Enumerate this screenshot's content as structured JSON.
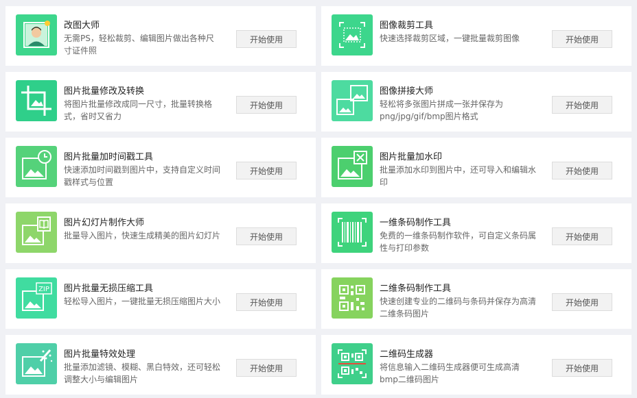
{
  "tools": [
    {
      "title": "改图大师",
      "desc": "无需PS，轻松裁剪、编辑图片做出各种尺寸证件照",
      "button": "开始使用",
      "icon": "id-photo-icon",
      "color": "#3dd68c"
    },
    {
      "title": "图像裁剪工具",
      "desc": "快速选择裁剪区域，一键批量裁剪图像",
      "button": "开始使用",
      "icon": "crop-area-icon",
      "color": "#3dd68c"
    },
    {
      "title": "图片批量修改及转换",
      "desc": "将图片批量修改成同一尺寸，批量转换格式，省时又省力",
      "button": "开始使用",
      "icon": "crop-resize-icon",
      "color": "#2fcf8a"
    },
    {
      "title": "图像拼接大师",
      "desc": "轻松将多张图片拼成一张并保存为png/jpg/gif/bmp图片格式",
      "button": "开始使用",
      "icon": "image-stitch-icon",
      "color": "#4ddba0"
    },
    {
      "title": "图片批量加时间戳工具",
      "desc": "快速添加时间戳到图片中，支持自定义时间戳样式与位置",
      "button": "开始使用",
      "icon": "timestamp-icon",
      "color": "#55d27a"
    },
    {
      "title": "图片批量加水印",
      "desc": "批量添加水印到图片中，还可导入和编辑水印",
      "button": "开始使用",
      "icon": "watermark-icon",
      "color": "#4ccf6e"
    },
    {
      "title": "图片幻灯片制作大师",
      "desc": "批量导入图片，快速生成精美的图片幻灯片",
      "button": "开始使用",
      "icon": "slideshow-icon",
      "color": "#8ed66a"
    },
    {
      "title": "一维条码制作工具",
      "desc": "免费的一维条码制作软件，可自定义条码属性与打印参数",
      "button": "开始使用",
      "icon": "barcode-icon",
      "color": "#3ed37c"
    },
    {
      "title": "图片批量无损压缩工具",
      "desc": "轻松导入图片，一键批量无损压缩图片大小",
      "button": "开始使用",
      "icon": "zip-compress-icon",
      "color": "#40dca0"
    },
    {
      "title": "二维条码制作工具",
      "desc": "快速创建专业的二维码与条码并保存为高清二维条码图片",
      "button": "开始使用",
      "icon": "qrcode-icon",
      "color": "#86d35e"
    },
    {
      "title": "图片批量特效处理",
      "desc": "批量添加滤镜、模糊、黑白特效，还可轻松调整大小与编辑图片",
      "button": "开始使用",
      "icon": "magic-wand-icon",
      "color": "#4fcfa8"
    },
    {
      "title": "二维码生成器",
      "desc": "将信息输入二维码生成器便可生成高清bmp二维码图片",
      "button": "开始使用",
      "icon": "qr-generator-icon",
      "color": "#3fcf8a"
    }
  ]
}
